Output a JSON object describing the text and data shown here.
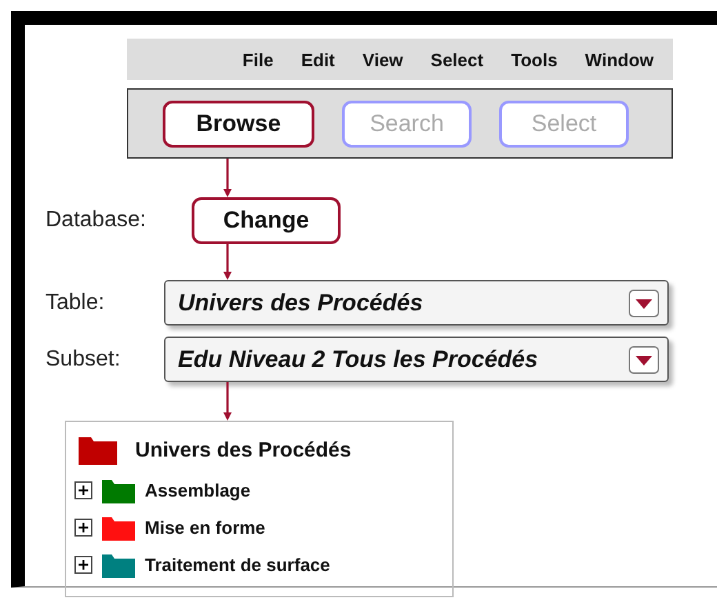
{
  "menu": [
    "File",
    "Edit",
    "View",
    "Select",
    "Tools",
    "Window"
  ],
  "toolbar": [
    {
      "label": "Browse",
      "selected": true
    },
    {
      "label": "Search",
      "selected": false
    },
    {
      "label": "Select",
      "selected": false
    }
  ],
  "database": {
    "label": "Database:",
    "button": "Change"
  },
  "selectors": [
    {
      "label": "Table:",
      "value": "Univers des Procédés"
    },
    {
      "label": "Subset:",
      "value": "Edu Niveau 2 Tous les Procédés"
    }
  ],
  "tree": {
    "label": "Univers des Procédés",
    "color": "#c00000",
    "children": [
      {
        "label": "Assemblage",
        "color": "#007a00",
        "expanded": false
      },
      {
        "label": "Mise en forme",
        "color": "#ff1010",
        "expanded": false
      },
      {
        "label": "Traitement de surface",
        "color": "#008080",
        "expanded": false
      }
    ]
  }
}
